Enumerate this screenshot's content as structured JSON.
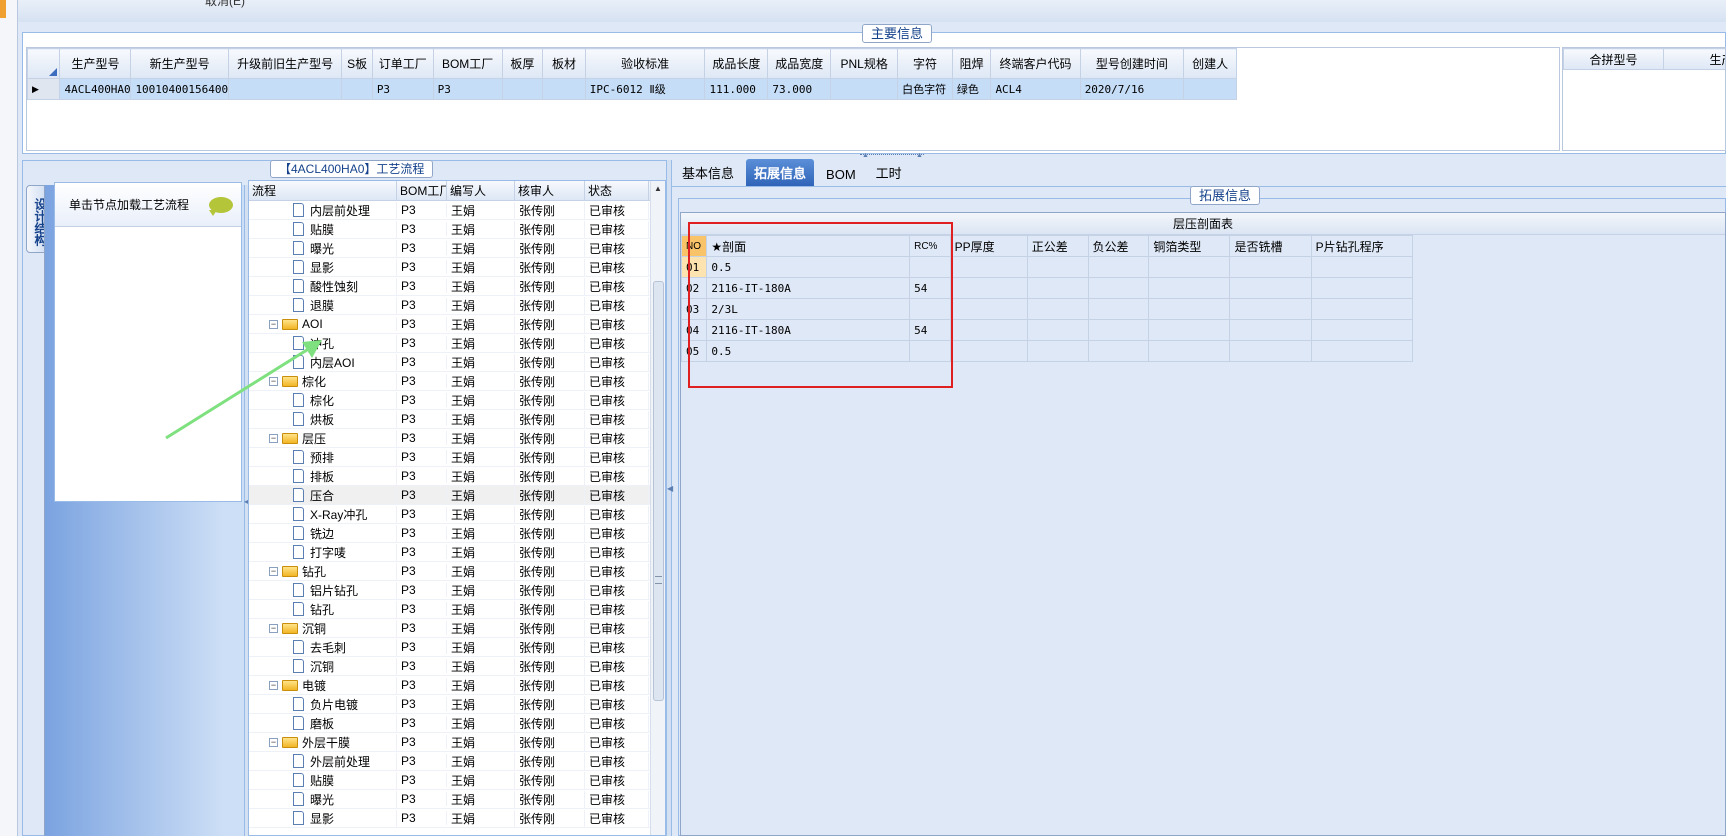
{
  "top_stub": "取消(E)",
  "main_info": {
    "title": "主要信息",
    "columns": [
      "生产型号",
      "新生产型号",
      "升级前旧生产型号",
      "S板",
      "订单工厂",
      "BOM工厂",
      "板厚",
      "板材",
      "验收标准",
      "成品长度",
      "成品宽度",
      "PNL规格",
      "字符",
      "阻焊",
      "终端客户代码",
      "型号创建时间",
      "创建人"
    ],
    "row": [
      "4ACL400HA0",
      "10010400156400",
      "",
      "",
      "P3",
      "P3",
      "",
      "",
      "IPC-6012 Ⅱ级",
      "111.000",
      "73.000",
      "",
      "白色字符",
      "绿色",
      "ACL4",
      "2020/7/16",
      ""
    ],
    "right_columns": [
      "合拼型号",
      "生产型号"
    ]
  },
  "side_tab": {
    "label": "设计结构"
  },
  "left_panel": {
    "hint": "单击节点加载工艺流程"
  },
  "process": {
    "title": "【4ACL400HA0】工艺流程",
    "columns": [
      "流程",
      "BOM工厂",
      "编写人",
      "核审人",
      "状态"
    ],
    "rows": [
      {
        "name": "内层前处理",
        "type": "doc",
        "factory": "P3",
        "writer": "王娟",
        "reviewer": "张传刚",
        "status": "已审核"
      },
      {
        "name": "贴膜",
        "type": "doc",
        "factory": "P3",
        "writer": "王娟",
        "reviewer": "张传刚",
        "status": "已审核"
      },
      {
        "name": "曝光",
        "type": "doc",
        "factory": "P3",
        "writer": "王娟",
        "reviewer": "张传刚",
        "status": "已审核"
      },
      {
        "name": "显影",
        "type": "doc",
        "factory": "P3",
        "writer": "王娟",
        "reviewer": "张传刚",
        "status": "已审核"
      },
      {
        "name": "酸性蚀刻",
        "type": "doc",
        "factory": "P3",
        "writer": "王娟",
        "reviewer": "张传刚",
        "status": "已审核"
      },
      {
        "name": "退膜",
        "type": "doc",
        "factory": "P3",
        "writer": "王娟",
        "reviewer": "张传刚",
        "status": "已审核"
      },
      {
        "name": "AOI",
        "type": "folder",
        "factory": "P3",
        "writer": "王娟",
        "reviewer": "张传刚",
        "status": "已审核"
      },
      {
        "name": "冲孔",
        "type": "doc",
        "factory": "P3",
        "writer": "王娟",
        "reviewer": "张传刚",
        "status": "已审核"
      },
      {
        "name": "内层AOI",
        "type": "doc",
        "factory": "P3",
        "writer": "王娟",
        "reviewer": "张传刚",
        "status": "已审核"
      },
      {
        "name": "棕化",
        "type": "folder",
        "factory": "P3",
        "writer": "王娟",
        "reviewer": "张传刚",
        "status": "已审核"
      },
      {
        "name": "棕化",
        "type": "doc",
        "factory": "P3",
        "writer": "王娟",
        "reviewer": "张传刚",
        "status": "已审核"
      },
      {
        "name": "烘板",
        "type": "doc",
        "factory": "P3",
        "writer": "王娟",
        "reviewer": "张传刚",
        "status": "已审核"
      },
      {
        "name": "层压",
        "type": "folder",
        "factory": "P3",
        "writer": "王娟",
        "reviewer": "张传刚",
        "status": "已审核"
      },
      {
        "name": "预排",
        "type": "doc",
        "factory": "P3",
        "writer": "王娟",
        "reviewer": "张传刚",
        "status": "已审核"
      },
      {
        "name": "排板",
        "type": "doc",
        "factory": "P3",
        "writer": "王娟",
        "reviewer": "张传刚",
        "status": "已审核"
      },
      {
        "name": "压合",
        "type": "doc",
        "factory": "P3",
        "writer": "王娟",
        "reviewer": "张传刚",
        "status": "已审核",
        "selected": true
      },
      {
        "name": "X-Ray冲孔",
        "type": "doc",
        "factory": "P3",
        "writer": "王娟",
        "reviewer": "张传刚",
        "status": "已审核"
      },
      {
        "name": "铣边",
        "type": "doc",
        "factory": "P3",
        "writer": "王娟",
        "reviewer": "张传刚",
        "status": "已审核"
      },
      {
        "name": "打字唛",
        "type": "doc",
        "factory": "P3",
        "writer": "王娟",
        "reviewer": "张传刚",
        "status": "已审核"
      },
      {
        "name": "钻孔",
        "type": "folder",
        "factory": "P3",
        "writer": "王娟",
        "reviewer": "张传刚",
        "status": "已审核"
      },
      {
        "name": "铝片钻孔",
        "type": "doc",
        "factory": "P3",
        "writer": "王娟",
        "reviewer": "张传刚",
        "status": "已审核"
      },
      {
        "name": "钻孔",
        "type": "doc",
        "factory": "P3",
        "writer": "王娟",
        "reviewer": "张传刚",
        "status": "已审核"
      },
      {
        "name": "沉铜",
        "type": "folder",
        "factory": "P3",
        "writer": "王娟",
        "reviewer": "张传刚",
        "status": "已审核"
      },
      {
        "name": "去毛刺",
        "type": "doc",
        "factory": "P3",
        "writer": "王娟",
        "reviewer": "张传刚",
        "status": "已审核"
      },
      {
        "name": "沉铜",
        "type": "doc",
        "factory": "P3",
        "writer": "王娟",
        "reviewer": "张传刚",
        "status": "已审核"
      },
      {
        "name": "电镀",
        "type": "folder",
        "factory": "P3",
        "writer": "王娟",
        "reviewer": "张传刚",
        "status": "已审核"
      },
      {
        "name": "负片电镀",
        "type": "doc",
        "factory": "P3",
        "writer": "王娟",
        "reviewer": "张传刚",
        "status": "已审核"
      },
      {
        "name": "磨板",
        "type": "doc",
        "factory": "P3",
        "writer": "王娟",
        "reviewer": "张传刚",
        "status": "已审核"
      },
      {
        "name": "外层干膜",
        "type": "folder",
        "factory": "P3",
        "writer": "王娟",
        "reviewer": "张传刚",
        "status": "已审核"
      },
      {
        "name": "外层前处理",
        "type": "doc",
        "factory": "P3",
        "writer": "王娟",
        "reviewer": "张传刚",
        "status": "已审核"
      },
      {
        "name": "贴膜",
        "type": "doc",
        "factory": "P3",
        "writer": "王娟",
        "reviewer": "张传刚",
        "status": "已审核"
      },
      {
        "name": "曝光",
        "type": "doc",
        "factory": "P3",
        "writer": "王娟",
        "reviewer": "张传刚",
        "status": "已审核"
      },
      {
        "name": "显影",
        "type": "doc",
        "factory": "P3",
        "writer": "王娟",
        "reviewer": "张传刚",
        "status": "已审核"
      }
    ]
  },
  "tabs": [
    {
      "label": "基本信息",
      "active": false
    },
    {
      "label": "拓展信息",
      "active": true
    },
    {
      "label": "BOM",
      "active": false
    },
    {
      "label": "工时",
      "active": false
    }
  ],
  "ext_info": {
    "title": "拓展信息",
    "table_title": "层压剖面表",
    "columns": [
      "NO",
      "★剖面",
      "RC%",
      "PP厚度",
      "正公差",
      "负公差",
      "铜箔类型",
      "是否铣槽",
      "P片钻孔程序"
    ],
    "rows": [
      [
        "01",
        "0.5",
        "",
        "",
        "",
        "",
        "",
        "",
        ""
      ],
      [
        "02",
        "2116-IT-180A",
        "54",
        "",
        "",
        "",
        "",
        "",
        ""
      ],
      [
        "03",
        "2/3L",
        "",
        "",
        "",
        "",
        "",
        "",
        ""
      ],
      [
        "04",
        "2116-IT-180A",
        "54",
        "",
        "",
        "",
        "",
        "",
        ""
      ],
      [
        "05",
        "0.5",
        "",
        "",
        "",
        "",
        "",
        "",
        ""
      ]
    ]
  },
  "colors": {
    "accent": "#3b6cc0",
    "selection": "#c5ddf7",
    "annotation_box": "#e02020",
    "annotation_arrow": "#7ee07e"
  }
}
